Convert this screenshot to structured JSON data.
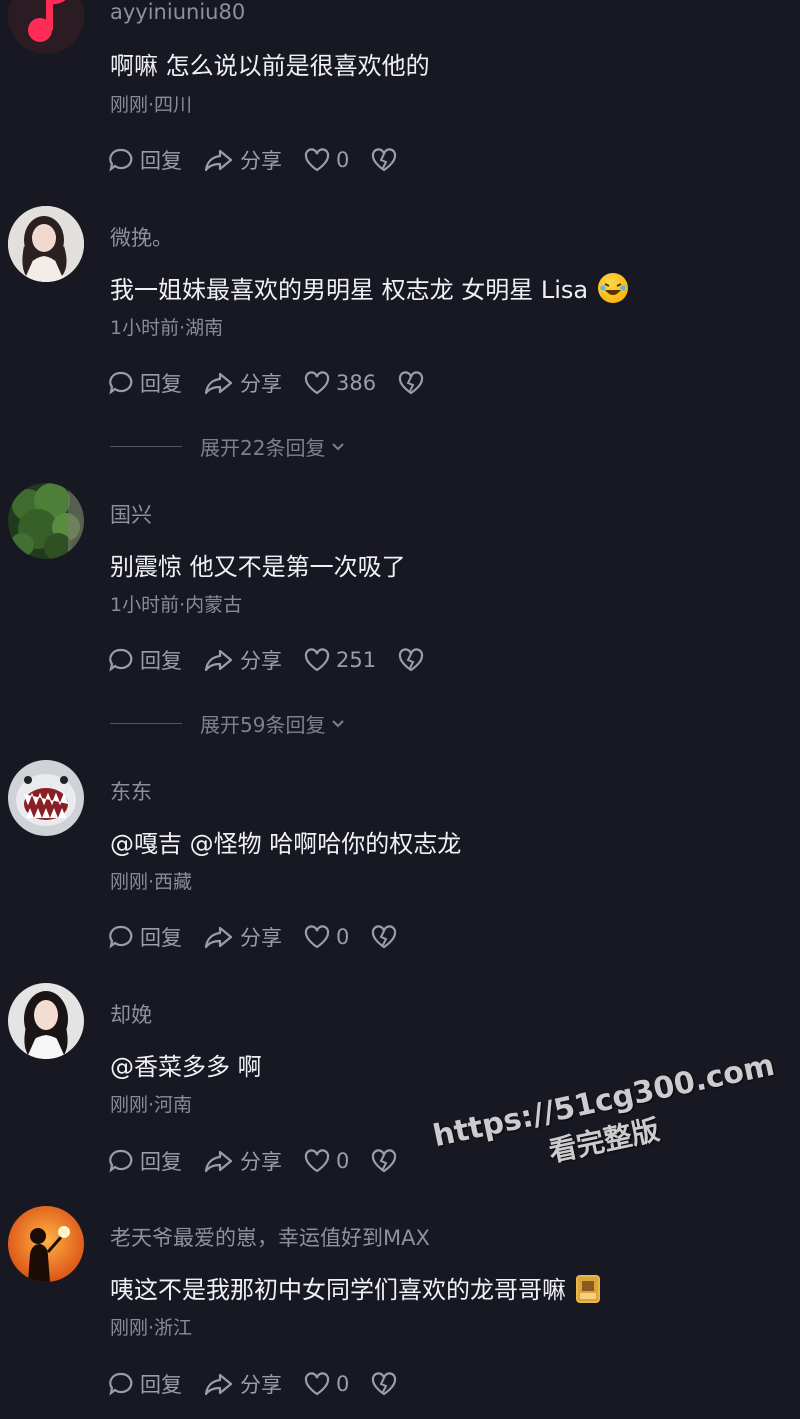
{
  "actions": {
    "reply": "回复",
    "share": "分享"
  },
  "comments": [
    {
      "username": "ayyiniuniu80",
      "text": "啊嘛 怎么说以前是很喜欢他的",
      "meta": "刚刚·四川",
      "likes": "0",
      "expand": ""
    },
    {
      "username": "微挽。",
      "text": "我一姐妹最喜欢的男明星 权志龙 女明星 Lisa",
      "meta": "1小时前·湖南",
      "likes": "386",
      "expand": "展开22条回复"
    },
    {
      "username": "国兴",
      "text": "别震惊 他又不是第一次吸了",
      "meta": "1小时前·内蒙古",
      "likes": "251",
      "expand": "展开59条回复"
    },
    {
      "username": "东东",
      "text": "@嘎吉 @怪物 哈啊哈你的权志龙",
      "meta": "刚刚·西藏",
      "likes": "0",
      "expand": ""
    },
    {
      "username": "却娩",
      "text": "@香菜多多 啊",
      "meta": "刚刚·河南",
      "likes": "0",
      "expand": ""
    },
    {
      "username": "老天爷最爱的崽，幸运值好到MAX",
      "text": "咦这不是我那初中女同学们喜欢的龙哥哥嘛",
      "meta": "刚刚·浙江",
      "likes": "0",
      "expand": ""
    }
  ],
  "watermark": {
    "line1": "https://51cg300.com",
    "line2": "看完整版"
  },
  "icons": [
    "music-note-icon",
    "comment-icon",
    "share-icon",
    "heart-icon",
    "broken-heart-icon",
    "chevron-down-icon",
    "laughing-emoji-icon",
    "sticker-icon"
  ],
  "colors": {
    "background": "#181822",
    "primary_text": "#f0f1f5",
    "secondary_text": "#8f909b",
    "app_red": "#fe2c55"
  }
}
